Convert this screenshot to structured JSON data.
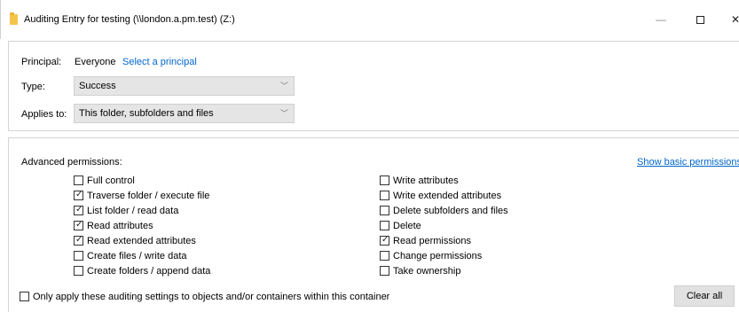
{
  "window": {
    "title": "Auditing Entry for testing (\\\\london.a.pm.test) (Z:)",
    "minimize": "—",
    "close": "✕"
  },
  "principal": {
    "label": "Principal:",
    "value": "Everyone",
    "link": "Select a principal"
  },
  "type": {
    "label": "Type:",
    "value": "Success"
  },
  "applies_to": {
    "label": "Applies to:",
    "value": "This folder, subfolders and files"
  },
  "advanced": {
    "label": "Advanced permissions:",
    "show_basic": "Show basic permissions",
    "left": [
      {
        "label": "Full control",
        "checked": false
      },
      {
        "label": "Traverse folder / execute file",
        "checked": true
      },
      {
        "label": "List folder / read data",
        "checked": true
      },
      {
        "label": "Read attributes",
        "checked": true
      },
      {
        "label": "Read extended attributes",
        "checked": true
      },
      {
        "label": "Create files / write data",
        "checked": false
      },
      {
        "label": "Create folders / append data",
        "checked": false
      }
    ],
    "right": [
      {
        "label": "Write attributes",
        "checked": false
      },
      {
        "label": "Write extended attributes",
        "checked": false
      },
      {
        "label": "Delete subfolders and files",
        "checked": false
      },
      {
        "label": "Delete",
        "checked": false
      },
      {
        "label": "Read permissions",
        "checked": true
      },
      {
        "label": "Change permissions",
        "checked": false
      },
      {
        "label": "Take ownership",
        "checked": false
      }
    ]
  },
  "only_apply": {
    "label": "Only apply these auditing settings to objects and/or containers within this container",
    "checked": false
  },
  "clear_all": "Clear all",
  "colors": {
    "link": "#0066cc",
    "select_bg": "#e5e5e5",
    "button_bg": "#e1e1e1",
    "folder": "#f3c54a"
  }
}
